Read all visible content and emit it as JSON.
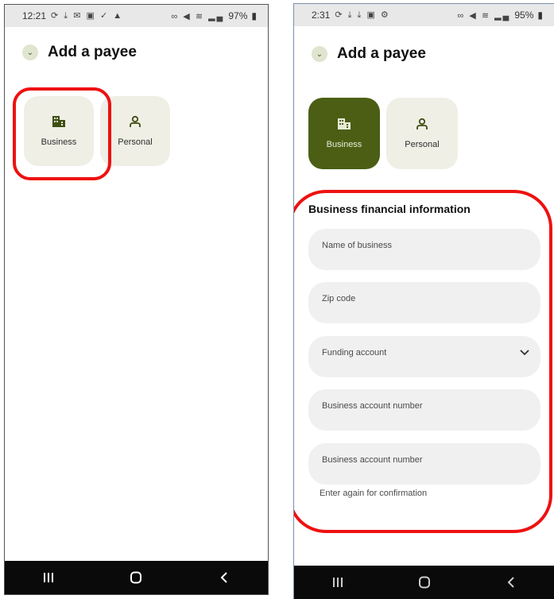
{
  "left_screen": {
    "status": {
      "time": "12:21",
      "battery": "97%"
    },
    "header": {
      "title": "Add a payee"
    },
    "payee_types": [
      {
        "label": "Business",
        "icon": "building-icon",
        "selected": false
      },
      {
        "label": "Personal",
        "icon": "person-icon",
        "selected": false
      }
    ]
  },
  "right_screen": {
    "status": {
      "time": "2:31",
      "battery": "95%"
    },
    "header": {
      "title": "Add a payee"
    },
    "payee_types": [
      {
        "label": "Business",
        "icon": "building-icon",
        "selected": true
      },
      {
        "label": "Personal",
        "icon": "person-icon",
        "selected": false
      }
    ],
    "form": {
      "section_title": "Business financial information",
      "fields": [
        {
          "placeholder": "Name of business"
        },
        {
          "placeholder": "Zip code"
        },
        {
          "placeholder": "Funding account",
          "type": "dropdown"
        },
        {
          "placeholder": "Business account number"
        },
        {
          "placeholder": "Business account number"
        }
      ],
      "helper_text": "Enter again for confirmation"
    }
  },
  "colors": {
    "accent": "#4b5e14",
    "card_bg": "#efefe6",
    "highlight": "#ee1111"
  }
}
